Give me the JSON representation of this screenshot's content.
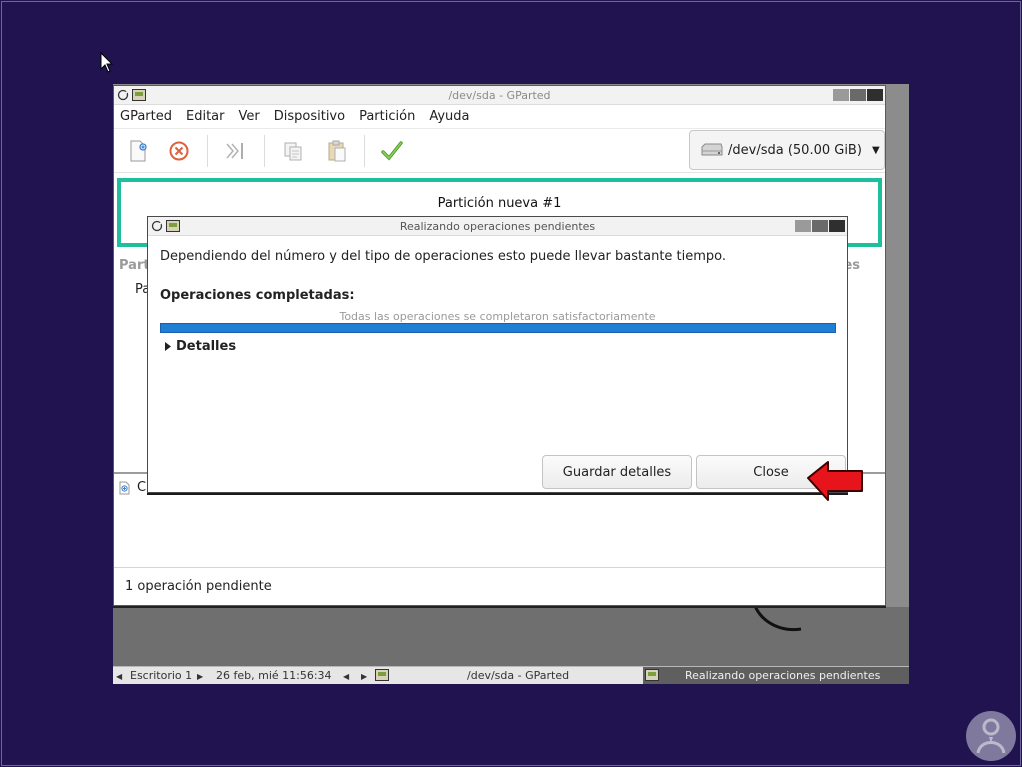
{
  "gparted": {
    "title": "/dev/sda - GParted",
    "menu": [
      "GParted",
      "Editar",
      "Ver",
      "Dispositivo",
      "Partición",
      "Ayuda"
    ],
    "device_selector": "/dev/sda  (50.00 GiB)",
    "partition_graphic_label": "Partición nueva #1",
    "table_header_left": "Part",
    "table_header_right": "es",
    "table_row_partial": "Pa",
    "pending_op_partial": "C",
    "status": "1 operación pendiente"
  },
  "dialog": {
    "title": "Realizando operaciones pendientes",
    "message": "Dependiendo del número y del tipo de operaciones esto puede llevar bastante tiempo.",
    "ops_label": "Operaciones completadas:",
    "progress_text": "Todas las operaciones se completaron satisfactoriamente",
    "progress": 1.0,
    "details_label": "Detalles",
    "save_button": "Guardar detalles",
    "close_button": "Close"
  },
  "taskbar": {
    "desktop": "Escritorio 1",
    "datetime": "26 feb, mié 11:56:34",
    "task_gparted": "/dev/sda - GParted",
    "task_active": "Realizando operaciones pendientes"
  },
  "colors": {
    "background": "#211250",
    "partition_border": "#1fbf9e",
    "progress_fill": "#1e7fd4",
    "annotation_arrow": "#e8141c"
  }
}
